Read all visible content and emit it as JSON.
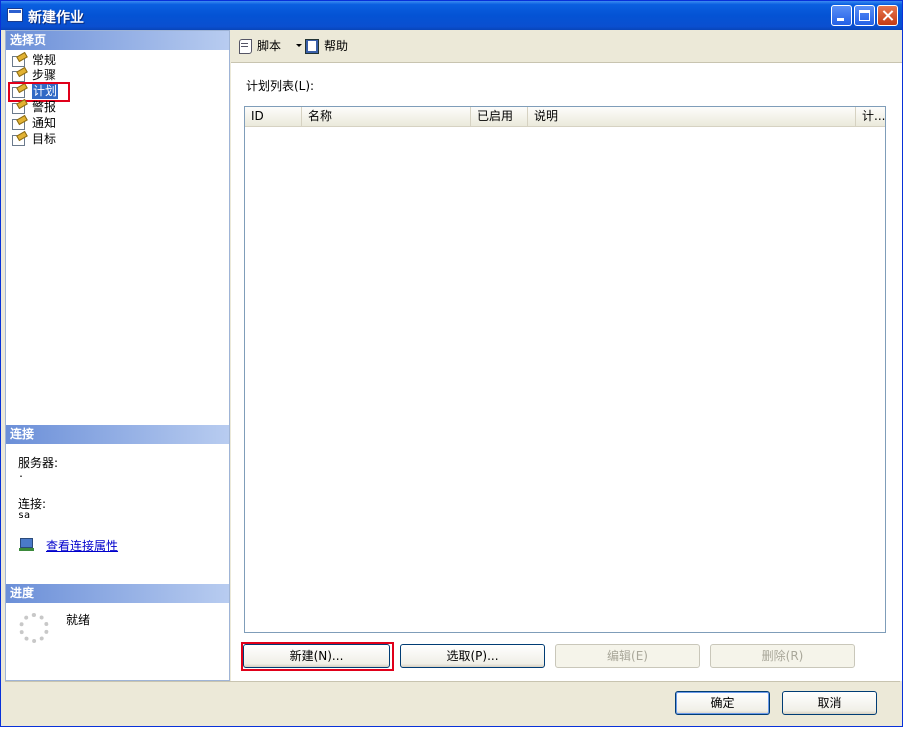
{
  "window": {
    "title": "新建作业"
  },
  "left": {
    "select_page_header": "选择页",
    "pages": [
      {
        "label": "常规",
        "selected": false
      },
      {
        "label": "步骤",
        "selected": false
      },
      {
        "label": "计划",
        "selected": true
      },
      {
        "label": "警报",
        "selected": false
      },
      {
        "label": "通知",
        "selected": false
      },
      {
        "label": "目标",
        "selected": false
      }
    ],
    "connection_header": "连接",
    "server_label": "服务器:",
    "server_value": ".",
    "connection_label": "连接:",
    "connection_value": "sa",
    "view_connection_link": "查看连接属性",
    "progress_header": "进度",
    "progress_status": "就绪"
  },
  "toolbar": {
    "script_label": "脚本",
    "help_label": "帮助"
  },
  "main": {
    "schedule_list_label": "计划列表(L):",
    "columns": [
      "ID",
      "名称",
      "已启用",
      "说明",
      "计..."
    ],
    "rows": []
  },
  "buttons": {
    "new": "新建(N)...",
    "pick": "选取(P)...",
    "edit": "编辑(E)",
    "delete": "删除(R)",
    "ok": "确定",
    "cancel": "取消"
  },
  "colors": {
    "highlight": "#e0001a",
    "selection": "#316ac5",
    "section_header": "#6b8fd8"
  }
}
